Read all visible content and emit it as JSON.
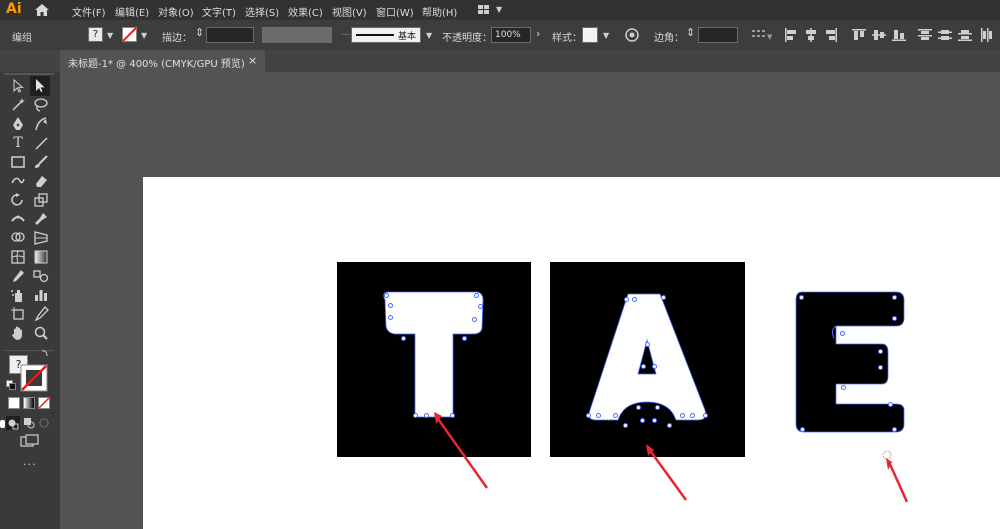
{
  "app": {
    "logo_text": "Ai"
  },
  "menu": {
    "items": [
      "文件(F)",
      "编辑(E)",
      "对象(O)",
      "文字(T)",
      "选择(S)",
      "效果(C)",
      "视图(V)",
      "窗口(W)",
      "帮助(H)"
    ]
  },
  "control": {
    "mode_label": "编组",
    "fill_indicator": "?",
    "stroke_label": "描边：",
    "brush_label": "基本",
    "opacity_label": "不透明度：",
    "opacity_value": "100%",
    "style_label": "样式：",
    "corner_label": "边角："
  },
  "document": {
    "tab_title": "未标题-1* @ 400% (CMYK/GPU 预览)",
    "close_glyph": "×"
  },
  "toolbar": {
    "fill_indicator": "?",
    "more_glyph": "···"
  },
  "letters": [
    "T",
    "A",
    "E"
  ],
  "colors": {
    "accent_anchor": "#4a6cff",
    "arrow": "#e8262d",
    "ui_dark": "#323232",
    "canvas_bg": "#535353",
    "logo": "#ff9a00"
  }
}
